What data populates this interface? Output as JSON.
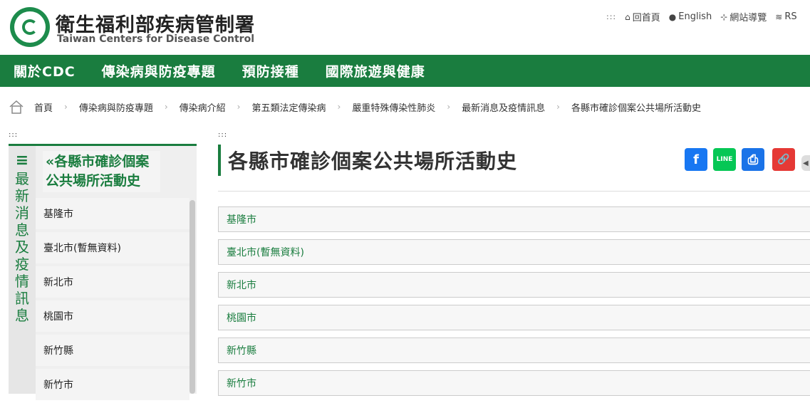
{
  "header": {
    "title_zh": "衛生福利部疾病管制署",
    "title_en": "Taiwan Centers for Disease Control",
    "top_links": [
      {
        "icon": "home-icon",
        "label": "回首頁"
      },
      {
        "icon": "globe-icon",
        "label": "English"
      },
      {
        "icon": "sitemap-icon",
        "label": "網站導覽"
      },
      {
        "icon": "rss-icon",
        "label": "RS"
      }
    ],
    "accessibility_marker": ":::"
  },
  "nav": {
    "items": [
      "關於CDC",
      "傳染病與防疫專題",
      "預防接種",
      "國際旅遊與健康"
    ]
  },
  "breadcrumb": [
    "首頁",
    "傳染病與防疫專題",
    "傳染病介紹",
    "第五類法定傳染病",
    "嚴重特殊傳染性肺炎",
    "最新消息及疫情訊息",
    "各縣市確診個案公共場所活動史"
  ],
  "sidebar": {
    "marker": ":::",
    "vertical_title": "最新消息及疫情訊息",
    "menu_icon": "≡",
    "heading": "«各縣市確診個案公共場所活動史",
    "items": [
      "基隆市",
      "臺北市(暫無資料)",
      "新北市",
      "桃園市",
      "新竹縣",
      "新竹市"
    ]
  },
  "content": {
    "marker": ":::",
    "title": "各縣市確診個案公共場所活動史",
    "share": [
      {
        "icon": "facebook-icon",
        "glyph": "f",
        "color": "#1877f2"
      },
      {
        "icon": "line-icon",
        "glyph": "LINE",
        "color": "#06c755"
      },
      {
        "icon": "print-icon",
        "glyph": "⎙",
        "color": "#1a73e8"
      },
      {
        "icon": "link-icon",
        "glyph": "🔗",
        "color": "#e53935"
      }
    ],
    "accordion": [
      "基隆市",
      "臺北市(暫無資料)",
      "新北市",
      "桃園市",
      "新竹縣",
      "新竹市"
    ]
  }
}
